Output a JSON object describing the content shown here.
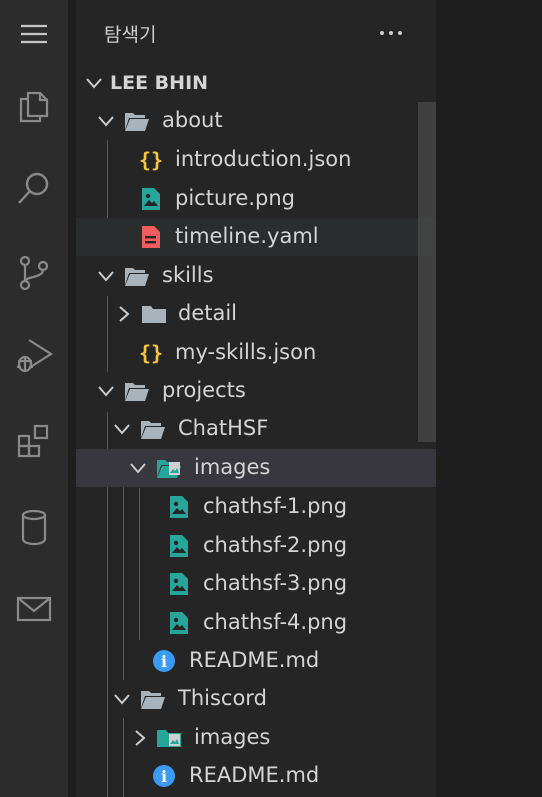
{
  "sidebar": {
    "title": "탐색기",
    "root": "LEE BHIN"
  },
  "tree": [
    {
      "label": "about"
    },
    {
      "label": "introduction.json",
      "icon_text": "{}"
    },
    {
      "label": "picture.png"
    },
    {
      "label": "timeline.yaml"
    },
    {
      "label": "skills"
    },
    {
      "label": "detail"
    },
    {
      "label": "my-skills.json",
      "icon_text": "{}"
    },
    {
      "label": "projects"
    },
    {
      "label": "ChatHSF"
    },
    {
      "label": "images"
    },
    {
      "label": "chathsf-1.png"
    },
    {
      "label": "chathsf-2.png"
    },
    {
      "label": "chathsf-3.png"
    },
    {
      "label": "chathsf-4.png"
    },
    {
      "label": "README.md",
      "icon_text": "i"
    },
    {
      "label": "Thiscord"
    },
    {
      "label": "images"
    },
    {
      "label": "README.md",
      "icon_text": "i"
    }
  ],
  "colors": {
    "json": "#f5c542",
    "image": "#26a69a",
    "yaml": "#f25c5c",
    "info": "#3b9cf6",
    "folder": "#a9b3bb"
  },
  "icons": [
    "menu-icon",
    "explorer-files-icon",
    "search-icon",
    "source-control-icon",
    "run-debug-icon",
    "extensions-icon",
    "database-icon",
    "mail-icon",
    "more-actions-icon"
  ]
}
